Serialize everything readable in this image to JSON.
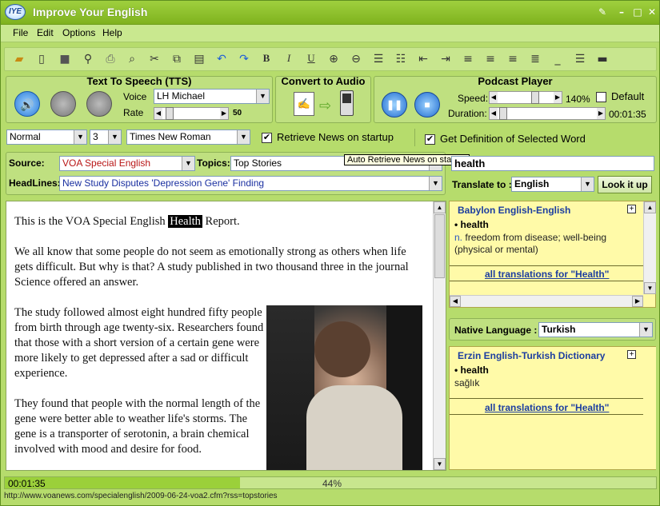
{
  "window": {
    "title": "Improve Your English",
    "logo_text": "IYE"
  },
  "menu": [
    "File",
    "Edit",
    "Options",
    "Help"
  ],
  "tts": {
    "title": "Text To Speech (TTS)",
    "voice_label": "Voice",
    "voice_value": "LH Michael",
    "rate_label": "Rate",
    "rate_value": "50"
  },
  "convert": {
    "title": "Convert to Audio"
  },
  "podcast": {
    "title": "Podcast Player",
    "speed_label": "Speed:",
    "speed_value": "140%",
    "default_label": "Default",
    "duration_label": "Duration:",
    "duration_value": "00:01:35"
  },
  "format": {
    "style": "Normal",
    "size": "3",
    "font": "Times New Roman",
    "retrieve_news_label": "Retrieve News on startup",
    "get_definition_label": "Get Definition of Selected Word"
  },
  "tooltip": "Auto Retrieve News on startup",
  "source": {
    "source_label": "Source:",
    "source_value": "VOA Special English",
    "topics_label": "Topics:",
    "topics_value": "Top Stories",
    "headlines_label": "HeadLines:",
    "headlines_value": "New Study Disputes 'Depression Gene' Finding"
  },
  "article": {
    "intro_before": "This is the VOA Special English ",
    "intro_highlight": "Health",
    "intro_after": " Report.",
    "p2": "We all know that some people do not seem as emotionally strong as others when life gets difficult. But why is that? A study published in two thousand three in the journal Science offered an answer.",
    "p3": "The study followed almost eight hundred fifty people from birth through age twenty-six. Researchers found that those with a short version of a certain gene were more likely to get depressed after a sad or difficult experience.",
    "p4": "They found that people with the normal length of the gene were better able to weather life's storms. The gene is a transporter of serotonin, a brain chemical involved with mood and desire for food."
  },
  "lookup": {
    "word": "health",
    "translate_label": "Translate to :",
    "translate_value": "English",
    "lookup_button": "Look it up"
  },
  "dict1": {
    "title": "Babylon English-English",
    "word": "health",
    "pos": "n.",
    "definition": "freedom from disease; well-being (physical or mental)",
    "link": "all translations for \"Health\""
  },
  "native": {
    "label": "Native Language :",
    "value": "Turkish"
  },
  "dict2": {
    "title": "Erzin English-Turkish Dictionary",
    "word": "health",
    "translation": "sağlık",
    "link": "all translations for \"Health\""
  },
  "status": {
    "time": "00:01:35",
    "percent": "44%",
    "progress": 0.44,
    "url": "http://www.voanews.com/specialenglish/2009-06-24-voa2.cfm?rss=topstories"
  },
  "colors": {
    "accent": "#7fb21e",
    "link": "#1c3ea0",
    "dict_bg": "#fffaa8"
  }
}
